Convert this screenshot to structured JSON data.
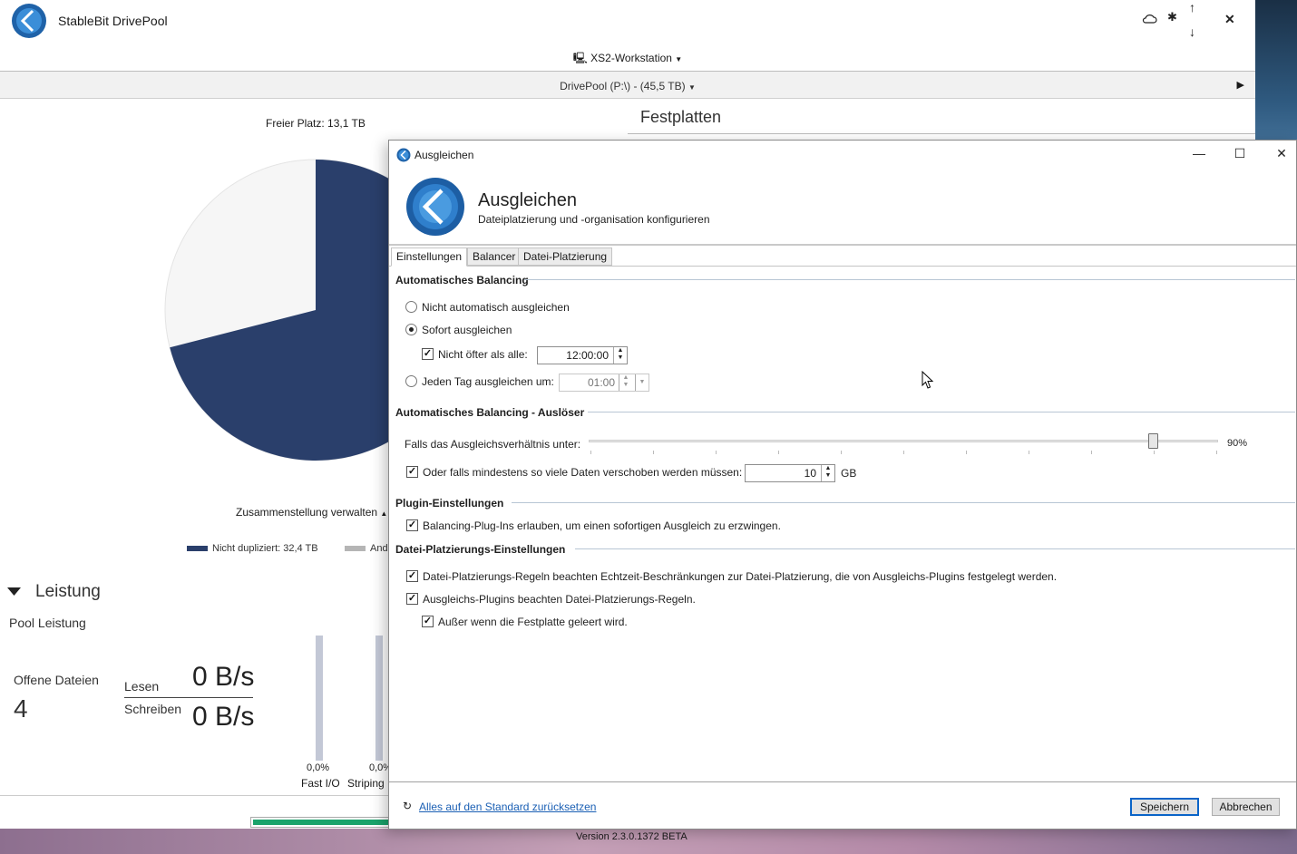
{
  "app": {
    "title": "StableBit DrivePool",
    "version": "Version 2.3.0.1372 BETA"
  },
  "toolbar": {
    "cloud_icon": "cloud-icon",
    "settings_icon": "gear-icon",
    "close_symbol": "✕",
    "up_symbol": "↑",
    "down_symbol": "↓"
  },
  "computer": {
    "name": "XS2-Workstation"
  },
  "pool": {
    "label": "DrivePool (P:\\) - (45,5 TB)"
  },
  "overview": {
    "free_space": "Freier Platz: 13,1 TB",
    "pie_fraction_non_duplicated": 0.71,
    "manage": "Zusammenstellung verwalten",
    "legend_nondup": "Nicht dupliziert: 32,4 TB",
    "legend_other": "And"
  },
  "disks": {
    "title": "Festplatten"
  },
  "performance": {
    "section_title": "Leistung",
    "pool_title": "Pool Leistung",
    "open_files_label": "Offene Dateien",
    "open_files_value": "4",
    "read_label": "Lesen",
    "read_value": "0 B/s",
    "write_label": "Schreiben",
    "write_value": "0 B/s",
    "fastio_pct": "0,0%",
    "fastio_label": "Fast I/O",
    "striping_pct": "0,0%",
    "striping_label": "Striping"
  },
  "progress": {
    "fraction": 0.97
  },
  "dialog": {
    "window_title": "Ausgleichen",
    "heading": "Ausgleichen",
    "subheading": "Dateiplatzierung und -organisation konfigurieren",
    "tabs": [
      {
        "label": "Einstellungen"
      },
      {
        "label": "Balancer"
      },
      {
        "label": "Datei-Platzierung"
      }
    ],
    "auto": {
      "title": "Automatisches Balancing",
      "opt_none": "Nicht automatisch ausgleichen",
      "opt_immediate": "Sofort ausgleichen",
      "not_more_often": "Nicht öfter als alle:",
      "not_more_often_value": "12:00:00",
      "opt_daily": "Jeden Tag ausgleichen um:",
      "daily_value": "01:00",
      "selected": "immediate"
    },
    "trigger": {
      "title": "Automatisches Balancing - Auslöser",
      "ratio_label": "Falls das Ausgleichsverhältnis unter:",
      "ratio_value": "90%",
      "ratio_fraction": 0.9,
      "data_label": "Oder falls mindestens so viele Daten verschoben werden müssen:",
      "data_value": "10",
      "data_unit": "GB"
    },
    "plugin": {
      "title": "Plugin-Einstellungen",
      "allow": "Balancing-Plug-Ins erlauben, um einen sofortigen Ausgleich zu erzwingen."
    },
    "placement": {
      "title": "Datei-Platzierungs-Einstellungen",
      "rule1": "Datei-Platzierungs-Regeln beachten Echtzeit-Beschränkungen zur Datei-Platzierung, die von Ausgleichs-Plugins festgelegt werden.",
      "rule2": "Ausgleichs-Plugins beachten Datei-Platzierungs-Regeln.",
      "rule3": "Außer wenn die Festplatte geleert wird."
    },
    "footer": {
      "reset": "Alles auf den Standard zurücksetzen",
      "save": "Speichern",
      "cancel": "Abbrechen"
    }
  },
  "colors": {
    "accent": "#2a3f6b",
    "pool_free": "#f6f6f6",
    "progress": "#1aa36b",
    "link": "#1a5fb4"
  }
}
